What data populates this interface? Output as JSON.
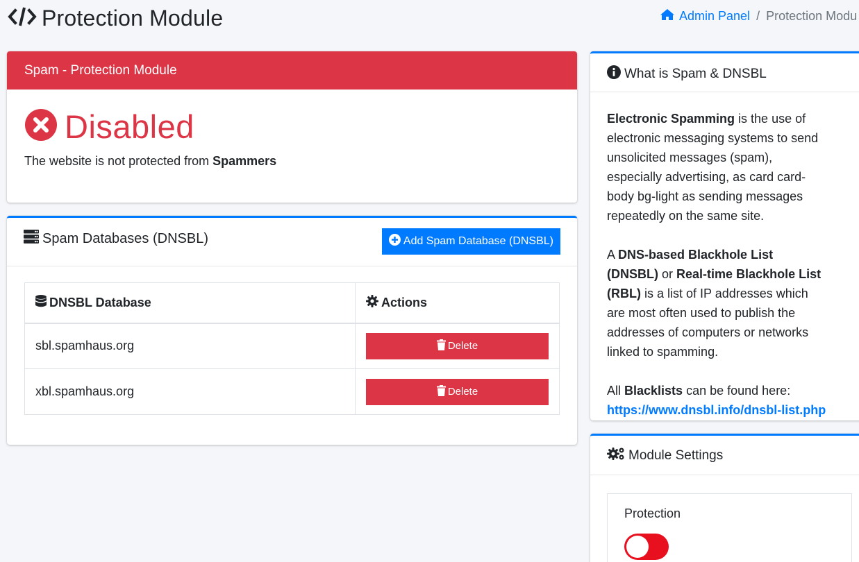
{
  "header": {
    "title": "Protection Module",
    "icon": "code-icon"
  },
  "breadcrumb": {
    "home_label": "Admin Panel",
    "separator": "/",
    "current": "Protection Modu"
  },
  "status_card": {
    "header": "Spam - Protection Module",
    "status": "Disabled",
    "status_color": "#dc3545",
    "description_prefix": "The website is not protected from ",
    "description_bold": "Spammers"
  },
  "db_card": {
    "title": "Spam Databases (DNSBL)",
    "add_button": "Add Spam Database (DNSBL)",
    "table": {
      "col_database": "DNSBL Database",
      "col_actions": "Actions",
      "rows": [
        {
          "database": "sbl.spamhaus.org",
          "action": "Delete"
        },
        {
          "database": "xbl.spamhaus.org",
          "action": "Delete"
        }
      ]
    }
  },
  "info_card": {
    "title": "What is Spam & DNSBL",
    "p1_bold": "Electronic Spamming",
    "p1_text": " is the use of electronic messaging systems to send unsolicited messages (spam), especially advertising, as card card-body bg-light as sending messages repeatedly on the same site.",
    "p2_prefix": "A ",
    "p2_bold1": "DNS-based Blackhole List (DNSBL)",
    "p2_mid": " or ",
    "p2_bold2": "Real-time Blackhole List (RBL)",
    "p2_text": " is a list of IP addresses which are most often used to publish the addresses of computers or networks linked to spamming.",
    "p3_prefix": "All ",
    "p3_bold": "Blacklists",
    "p3_text": " can be found here:",
    "link": "https://www.dnsbl.info/dnsbl-list.php"
  },
  "settings_card": {
    "title": "Module Settings",
    "setting_label": "Protection",
    "toggle_on": false,
    "toggle_color": "#e8101f"
  },
  "colors": {
    "primary": "#007bff",
    "danger": "#dc3545"
  }
}
